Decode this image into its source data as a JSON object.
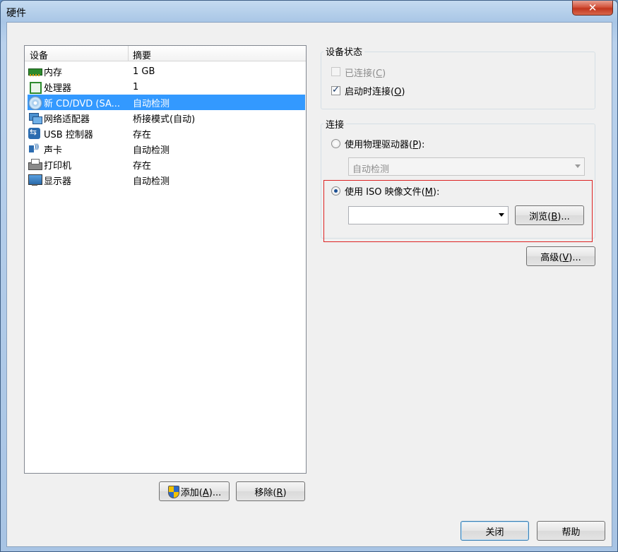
{
  "window": {
    "title": "硬件",
    "close_symbol": "✕"
  },
  "device_list": {
    "headers": {
      "device": "设备",
      "summary": "摘要"
    },
    "rows": [
      {
        "icon": "memory-icon",
        "name": "内存",
        "summary": "1 GB"
      },
      {
        "icon": "processor-icon",
        "name": "处理器",
        "summary": "1"
      },
      {
        "icon": "cd-dvd-icon",
        "name": "新 CD/DVD (SA...",
        "summary": "自动检测"
      },
      {
        "icon": "network-adapter-icon",
        "name": "网络适配器",
        "summary": "桥接模式(自动)"
      },
      {
        "icon": "usb-icon",
        "name": "USB 控制器",
        "summary": "存在"
      },
      {
        "icon": "sound-card-icon",
        "name": "声卡",
        "summary": "自动检测"
      },
      {
        "icon": "printer-icon",
        "name": "打印机",
        "summary": "存在"
      },
      {
        "icon": "display-icon",
        "name": "显示器",
        "summary": "自动检测"
      }
    ],
    "selected_index": 2
  },
  "buttons": {
    "add": {
      "text": "添加(",
      "key": "A",
      "suffix": ")..."
    },
    "remove": {
      "text": "移除(",
      "key": "R",
      "suffix": ")"
    },
    "close": "关闭",
    "help": "帮助",
    "browse": {
      "text": "浏览(",
      "key": "B",
      "suffix": ")..."
    },
    "advanced": {
      "text": "高级(",
      "key": "V",
      "suffix": ")..."
    }
  },
  "device_status": {
    "title": "设备状态",
    "connected": {
      "text": "已连接(",
      "key": "C",
      "suffix": ")",
      "checked": false,
      "enabled": false
    },
    "connect_at_power_on": {
      "text": "启动时连接(",
      "key": "O",
      "suffix": ")",
      "checked": true,
      "enabled": true
    }
  },
  "connection": {
    "title": "连接",
    "physical_drive": {
      "text": "使用物理驱动器(",
      "key": "P",
      "suffix": "):",
      "selected": false
    },
    "physical_drive_value": "自动检测",
    "iso_image": {
      "text": "使用 ISO 映像文件(",
      "key": "M",
      "suffix": "):",
      "selected": true
    },
    "iso_path_value": ""
  },
  "colors": {
    "selection": "#3399ff",
    "highlight_border": "#dd2222"
  }
}
